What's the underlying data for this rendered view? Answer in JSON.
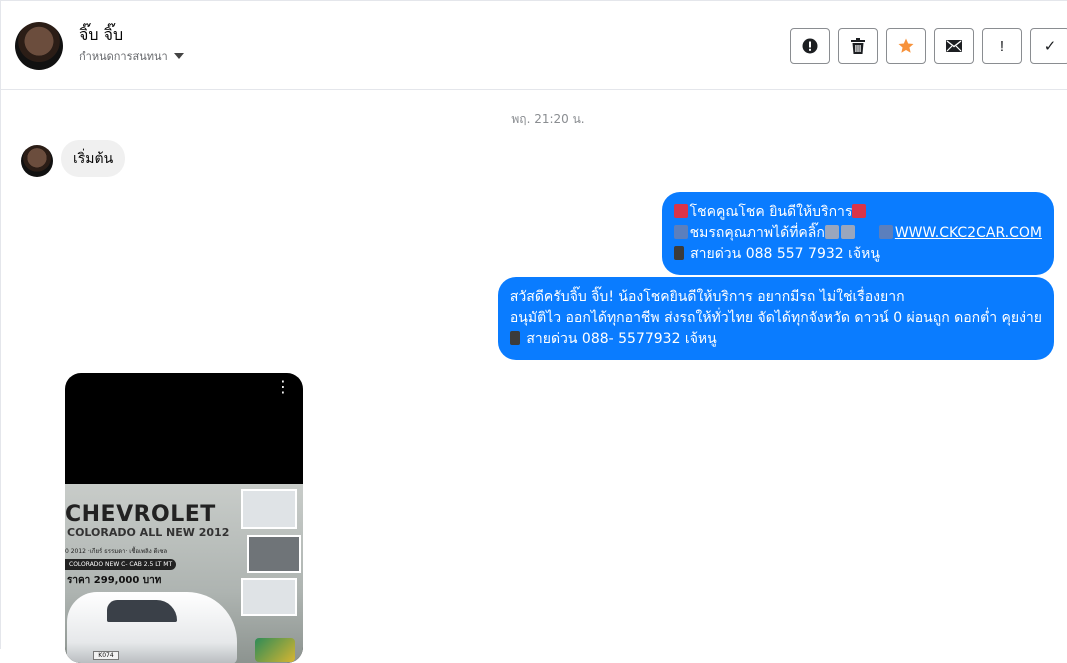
{
  "header": {
    "name": "จิ๊บ จิ๊บ",
    "subtitle": "กำหนดการสนทนา",
    "actions": [
      {
        "name": "report-button",
        "icon": "alert-circle-icon"
      },
      {
        "name": "delete-button",
        "icon": "trash-icon"
      },
      {
        "name": "star-button",
        "icon": "star-icon",
        "color": "#f7923b"
      },
      {
        "name": "mark-unread-button",
        "icon": "envelope-icon"
      },
      {
        "name": "important-button",
        "icon": "exclamation-icon",
        "glyph": "!"
      },
      {
        "name": "done-button",
        "icon": "check-icon",
        "glyph": "✓"
      }
    ]
  },
  "thread": {
    "timestamp": "พฤ. 21:20 น.",
    "incoming": {
      "text": "เริ่มต้น"
    },
    "outgoing": [
      {
        "line1": "โชคคูณโชค ยินดีให้บริการ",
        "line2a": "ชมรถคุณภาพได้ที่คลิ๊ก",
        "link": "WWW.CKC2CAR.COM",
        "line3": "สายด่วน 088 557 7932 เจ้หนู"
      },
      {
        "line1": "สวัสดีครับจิ๊บ จิ๊บ! น้องโชคยินดีให้บริการ อยากมีรถ ไม่ใช่เรื่องยาก",
        "line2": "อนุมัติไว ออกได้ทุกอาชีพ ส่งรถให้ทั่วไทย จัดได้ทุกจังหวัด ดาวน์ 0  ผ่อนถูก ดอกต่ำ คุยง่าย",
        "line3": "สายด่วน 088- 5577932 เจ้หนู"
      }
    ]
  },
  "attachment": {
    "menu": "⋮",
    "brand": "CHEVROLET",
    "model": "COLORADO ALL NEW 2012",
    "spec": "0 2012 ·เกียร์ ธรรมดา·  เชื้อเพลิง ดีเซล",
    "tag": "COLORADO NEW C- CAB 2.5 LT MT",
    "price": "ราคา 299,000 บาท",
    "plate": "K074"
  },
  "colors": {
    "outgoing_bubble": "#0a7cff",
    "incoming_bubble": "#f0f0f0"
  }
}
